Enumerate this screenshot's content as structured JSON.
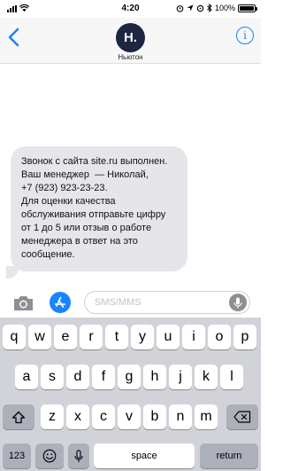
{
  "status_bar": {
    "time": "4:20",
    "battery": "100%",
    "icons": [
      "signal-icon",
      "wifi-icon",
      "alarm-icon",
      "location-icon",
      "bluetooth-icon",
      "battery-icon"
    ]
  },
  "header": {
    "avatar_text": "H.",
    "contact_name": "Ньютон",
    "back_icon": "chevron-left-icon",
    "info_icon": "info-icon",
    "accent_color": "#1a84ff"
  },
  "message": {
    "lines": [
      "Звонок с сайта site.ru выполнен.",
      "Ваш менеджер  — Николай,",
      "+7 (923) 923-23-23.",
      "Для оценки качества",
      "обслуживания отправьте цифру",
      "от 1 до 5 или отзыв о работе",
      "менеджера в ответ на это",
      "сообщение."
    ]
  },
  "input_bar": {
    "placeholder": "SMS/MMS",
    "value": "",
    "camera_icon": "camera-icon",
    "apps_icon": "app-store-icon",
    "mic_icon": "microphone-icon"
  },
  "keyboard": {
    "row1": [
      "q",
      "w",
      "e",
      "r",
      "t",
      "y",
      "u",
      "i",
      "o",
      "p"
    ],
    "row2": [
      "a",
      "s",
      "d",
      "f",
      "g",
      "h",
      "j",
      "k",
      "l"
    ],
    "row3": [
      "z",
      "x",
      "c",
      "v",
      "b",
      "n",
      "m"
    ],
    "numbers_label": "123",
    "space_label": "space",
    "return_label": "return",
    "shift_icon": "shift-icon",
    "delete_icon": "delete-icon",
    "emoji_icon": "emoji-icon",
    "dictation_icon": "microphone-icon"
  }
}
